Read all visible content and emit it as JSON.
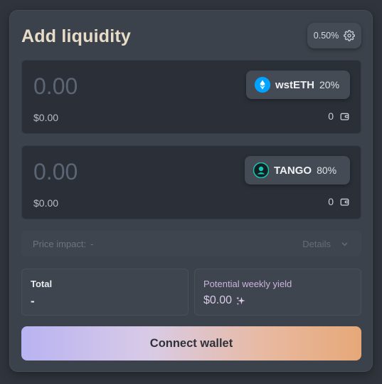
{
  "header": {
    "title": "Add liquidity",
    "slippage": "0.50%",
    "settings_icon": "gear-icon"
  },
  "tokens": [
    {
      "amount_placeholder": "0.00",
      "symbol": "wstETH",
      "weight": "20%",
      "usd_value": "$0.00",
      "balance": "0",
      "logo_icon": "wsteth-logo-icon",
      "logo_color": "#00a3ff"
    },
    {
      "amount_placeholder": "0.00",
      "symbol": "TANGO",
      "weight": "80%",
      "usd_value": "$0.00",
      "balance": "0",
      "logo_icon": "tango-logo-icon",
      "logo_color": "#17c3b2"
    }
  ],
  "price_impact": {
    "label": "Price impact:",
    "value": "-",
    "details_label": "Details"
  },
  "total": {
    "label": "Total",
    "value": "-"
  },
  "yield": {
    "label": "Potential weekly yield",
    "value": "$0.00",
    "icon": "sparkles-icon"
  },
  "actions": {
    "connect_label": "Connect wallet"
  },
  "colors": {
    "background": "#30353d",
    "card": "#3c424b",
    "panel": "#2b3038",
    "title": "#e9dcc7",
    "gradient_start": "#b8b3f2",
    "gradient_end": "#e6a878"
  }
}
